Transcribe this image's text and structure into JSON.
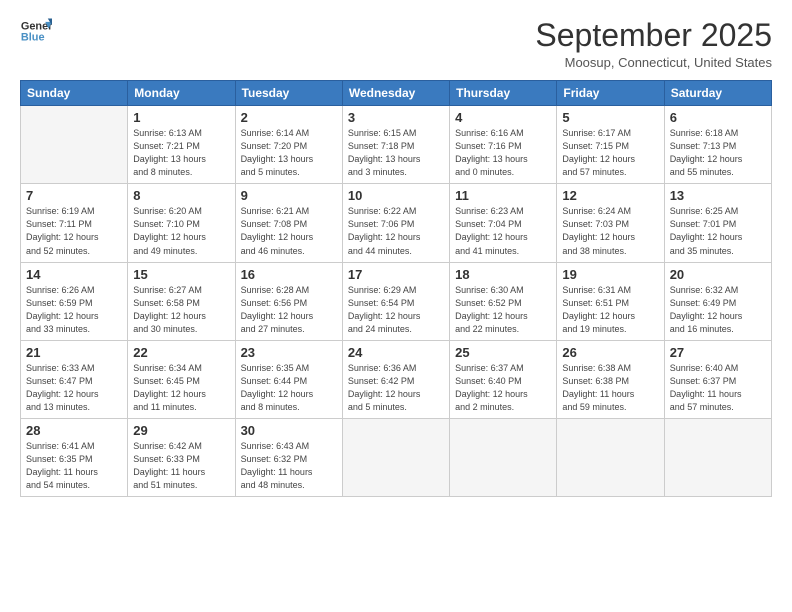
{
  "logo": {
    "line1": "General",
    "line2": "Blue"
  },
  "header": {
    "month": "September 2025",
    "location": "Moosup, Connecticut, United States"
  },
  "weekdays": [
    "Sunday",
    "Monday",
    "Tuesday",
    "Wednesday",
    "Thursday",
    "Friday",
    "Saturday"
  ],
  "weeks": [
    [
      {
        "day": "",
        "info": ""
      },
      {
        "day": "1",
        "info": "Sunrise: 6:13 AM\nSunset: 7:21 PM\nDaylight: 13 hours\nand 8 minutes."
      },
      {
        "day": "2",
        "info": "Sunrise: 6:14 AM\nSunset: 7:20 PM\nDaylight: 13 hours\nand 5 minutes."
      },
      {
        "day": "3",
        "info": "Sunrise: 6:15 AM\nSunset: 7:18 PM\nDaylight: 13 hours\nand 3 minutes."
      },
      {
        "day": "4",
        "info": "Sunrise: 6:16 AM\nSunset: 7:16 PM\nDaylight: 13 hours\nand 0 minutes."
      },
      {
        "day": "5",
        "info": "Sunrise: 6:17 AM\nSunset: 7:15 PM\nDaylight: 12 hours\nand 57 minutes."
      },
      {
        "day": "6",
        "info": "Sunrise: 6:18 AM\nSunset: 7:13 PM\nDaylight: 12 hours\nand 55 minutes."
      }
    ],
    [
      {
        "day": "7",
        "info": "Sunrise: 6:19 AM\nSunset: 7:11 PM\nDaylight: 12 hours\nand 52 minutes."
      },
      {
        "day": "8",
        "info": "Sunrise: 6:20 AM\nSunset: 7:10 PM\nDaylight: 12 hours\nand 49 minutes."
      },
      {
        "day": "9",
        "info": "Sunrise: 6:21 AM\nSunset: 7:08 PM\nDaylight: 12 hours\nand 46 minutes."
      },
      {
        "day": "10",
        "info": "Sunrise: 6:22 AM\nSunset: 7:06 PM\nDaylight: 12 hours\nand 44 minutes."
      },
      {
        "day": "11",
        "info": "Sunrise: 6:23 AM\nSunset: 7:04 PM\nDaylight: 12 hours\nand 41 minutes."
      },
      {
        "day": "12",
        "info": "Sunrise: 6:24 AM\nSunset: 7:03 PM\nDaylight: 12 hours\nand 38 minutes."
      },
      {
        "day": "13",
        "info": "Sunrise: 6:25 AM\nSunset: 7:01 PM\nDaylight: 12 hours\nand 35 minutes."
      }
    ],
    [
      {
        "day": "14",
        "info": "Sunrise: 6:26 AM\nSunset: 6:59 PM\nDaylight: 12 hours\nand 33 minutes."
      },
      {
        "day": "15",
        "info": "Sunrise: 6:27 AM\nSunset: 6:58 PM\nDaylight: 12 hours\nand 30 minutes."
      },
      {
        "day": "16",
        "info": "Sunrise: 6:28 AM\nSunset: 6:56 PM\nDaylight: 12 hours\nand 27 minutes."
      },
      {
        "day": "17",
        "info": "Sunrise: 6:29 AM\nSunset: 6:54 PM\nDaylight: 12 hours\nand 24 minutes."
      },
      {
        "day": "18",
        "info": "Sunrise: 6:30 AM\nSunset: 6:52 PM\nDaylight: 12 hours\nand 22 minutes."
      },
      {
        "day": "19",
        "info": "Sunrise: 6:31 AM\nSunset: 6:51 PM\nDaylight: 12 hours\nand 19 minutes."
      },
      {
        "day": "20",
        "info": "Sunrise: 6:32 AM\nSunset: 6:49 PM\nDaylight: 12 hours\nand 16 minutes."
      }
    ],
    [
      {
        "day": "21",
        "info": "Sunrise: 6:33 AM\nSunset: 6:47 PM\nDaylight: 12 hours\nand 13 minutes."
      },
      {
        "day": "22",
        "info": "Sunrise: 6:34 AM\nSunset: 6:45 PM\nDaylight: 12 hours\nand 11 minutes."
      },
      {
        "day": "23",
        "info": "Sunrise: 6:35 AM\nSunset: 6:44 PM\nDaylight: 12 hours\nand 8 minutes."
      },
      {
        "day": "24",
        "info": "Sunrise: 6:36 AM\nSunset: 6:42 PM\nDaylight: 12 hours\nand 5 minutes."
      },
      {
        "day": "25",
        "info": "Sunrise: 6:37 AM\nSunset: 6:40 PM\nDaylight: 12 hours\nand 2 minutes."
      },
      {
        "day": "26",
        "info": "Sunrise: 6:38 AM\nSunset: 6:38 PM\nDaylight: 11 hours\nand 59 minutes."
      },
      {
        "day": "27",
        "info": "Sunrise: 6:40 AM\nSunset: 6:37 PM\nDaylight: 11 hours\nand 57 minutes."
      }
    ],
    [
      {
        "day": "28",
        "info": "Sunrise: 6:41 AM\nSunset: 6:35 PM\nDaylight: 11 hours\nand 54 minutes."
      },
      {
        "day": "29",
        "info": "Sunrise: 6:42 AM\nSunset: 6:33 PM\nDaylight: 11 hours\nand 51 minutes."
      },
      {
        "day": "30",
        "info": "Sunrise: 6:43 AM\nSunset: 6:32 PM\nDaylight: 11 hours\nand 48 minutes."
      },
      {
        "day": "",
        "info": ""
      },
      {
        "day": "",
        "info": ""
      },
      {
        "day": "",
        "info": ""
      },
      {
        "day": "",
        "info": ""
      }
    ]
  ]
}
